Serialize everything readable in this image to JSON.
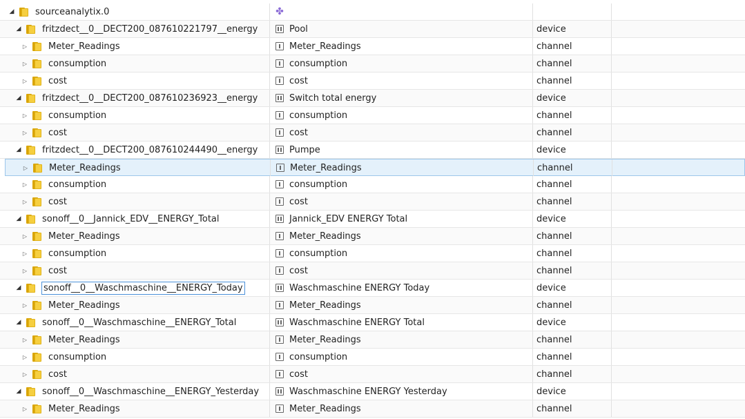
{
  "rows": [
    {
      "id": "sourceanalytix.0",
      "name": "",
      "type": "",
      "level": 0,
      "expanded": true,
      "icon": "adapter-icon"
    },
    {
      "id": "fritzdect__0__DECT200_087610221797__energy",
      "name": "Pool",
      "type": "device",
      "level": 1,
      "expanded": true,
      "icon": "device-icon"
    },
    {
      "id": "Meter_Readings",
      "name": "Meter_Readings",
      "type": "channel",
      "level": 2,
      "expanded": false,
      "icon": "channel-icon"
    },
    {
      "id": "consumption",
      "name": "consumption",
      "type": "channel",
      "level": 2,
      "expanded": false,
      "icon": "channel-icon"
    },
    {
      "id": "cost",
      "name": "cost",
      "type": "channel",
      "level": 2,
      "expanded": false,
      "icon": "channel-icon"
    },
    {
      "id": "fritzdect__0__DECT200_087610236923__energy",
      "name": "Switch total energy",
      "type": "device",
      "level": 1,
      "expanded": true,
      "icon": "device-icon"
    },
    {
      "id": "consumption",
      "name": "consumption",
      "type": "channel",
      "level": 2,
      "expanded": false,
      "icon": "channel-icon"
    },
    {
      "id": "cost",
      "name": "cost",
      "type": "channel",
      "level": 2,
      "expanded": false,
      "icon": "channel-icon"
    },
    {
      "id": "fritzdect__0__DECT200_087610244490__energy",
      "name": "Pumpe",
      "type": "device",
      "level": 1,
      "expanded": true,
      "icon": "device-icon"
    },
    {
      "id": "Meter_Readings",
      "name": "Meter_Readings",
      "type": "channel",
      "level": 2,
      "expanded": false,
      "icon": "channel-icon",
      "selected": true
    },
    {
      "id": "consumption",
      "name": "consumption",
      "type": "channel",
      "level": 2,
      "expanded": false,
      "icon": "channel-icon"
    },
    {
      "id": "cost",
      "name": "cost",
      "type": "channel",
      "level": 2,
      "expanded": false,
      "icon": "channel-icon"
    },
    {
      "id": "sonoff__0__Jannick_EDV__ENERGY_Total",
      "name": "Jannick_EDV ENERGY Total",
      "type": "device",
      "level": 1,
      "expanded": true,
      "icon": "device-icon"
    },
    {
      "id": "Meter_Readings",
      "name": "Meter_Readings",
      "type": "channel",
      "level": 2,
      "expanded": false,
      "icon": "channel-icon"
    },
    {
      "id": "consumption",
      "name": "consumption",
      "type": "channel",
      "level": 2,
      "expanded": false,
      "icon": "channel-icon"
    },
    {
      "id": "cost",
      "name": "cost",
      "type": "channel",
      "level": 2,
      "expanded": false,
      "icon": "channel-icon"
    },
    {
      "id": "sonoff__0__Waschmaschine__ENERGY_Today",
      "name": "Waschmaschine ENERGY Today",
      "type": "device",
      "level": 1,
      "expanded": true,
      "icon": "device-icon",
      "editing": true
    },
    {
      "id": "Meter_Readings",
      "name": "Meter_Readings",
      "type": "channel",
      "level": 2,
      "expanded": false,
      "icon": "channel-icon"
    },
    {
      "id": "sonoff__0__Waschmaschine__ENERGY_Total",
      "name": "Waschmaschine ENERGY Total",
      "type": "device",
      "level": 1,
      "expanded": true,
      "icon": "device-icon"
    },
    {
      "id": "Meter_Readings",
      "name": "Meter_Readings",
      "type": "channel",
      "level": 2,
      "expanded": false,
      "icon": "channel-icon"
    },
    {
      "id": "consumption",
      "name": "consumption",
      "type": "channel",
      "level": 2,
      "expanded": false,
      "icon": "channel-icon"
    },
    {
      "id": "cost",
      "name": "cost",
      "type": "channel",
      "level": 2,
      "expanded": false,
      "icon": "channel-icon"
    },
    {
      "id": "sonoff__0__Waschmaschine__ENERGY_Yesterday",
      "name": "Waschmaschine ENERGY Yesterday",
      "type": "device",
      "level": 1,
      "expanded": true,
      "icon": "device-icon"
    },
    {
      "id": "Meter_Readings",
      "name": "Meter_Readings",
      "type": "channel",
      "level": 2,
      "expanded": false,
      "icon": "channel-icon"
    }
  ]
}
